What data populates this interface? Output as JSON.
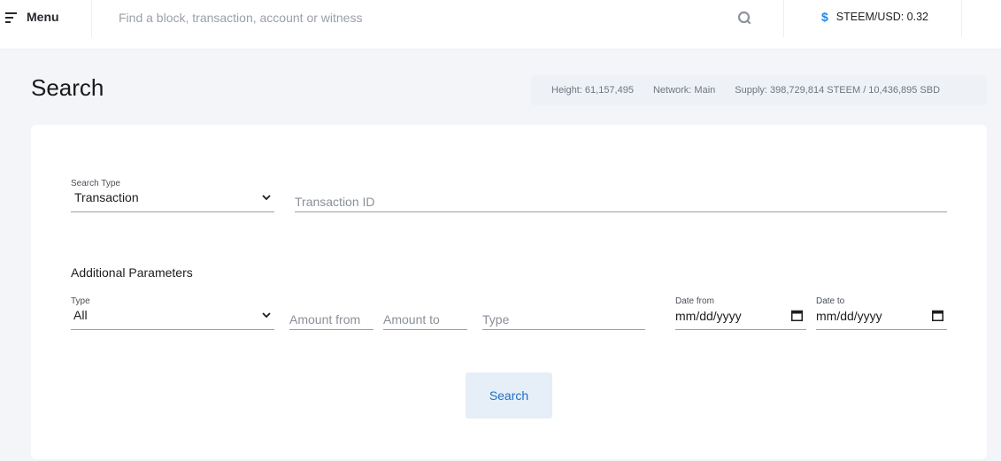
{
  "topbar": {
    "menu_label": "Menu",
    "search_placeholder": "Find a block, transaction, account or witness",
    "price_symbol": "$",
    "price_text": "STEEM/USD: 0.32"
  },
  "header": {
    "title": "Search",
    "stats": {
      "height": "Height: 61,157,495",
      "network": "Network: Main",
      "supply": "Supply: 398,729,814 STEEM / 10,436,895 SBD"
    }
  },
  "form": {
    "search_type_label": "Search Type",
    "search_type_value": "Transaction",
    "transaction_id_placeholder": "Transaction ID",
    "additional_title": "Additional Parameters",
    "type_label": "Type",
    "type_value": "All",
    "amount_from_placeholder": "Amount from",
    "amount_to_placeholder": "Amount to",
    "op_type_placeholder": "Type",
    "date_from_label": "Date from",
    "date_from_value": "mm/dd/yyyy",
    "date_to_label": "Date to",
    "date_to_value": "mm/dd/yyyy",
    "search_button_label": "Search"
  },
  "colors": {
    "accent": "#1e88e5",
    "background": "#f3f5f9",
    "button_bg": "#e6eef7"
  }
}
